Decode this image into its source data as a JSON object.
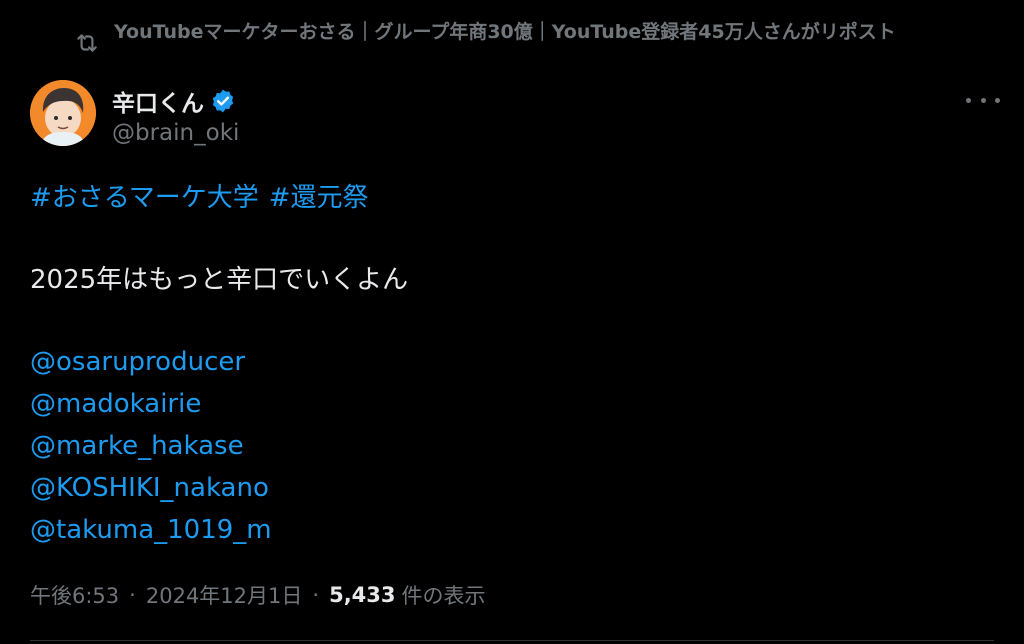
{
  "repost": {
    "text": "YouTubeマーケターおさる｜グループ年商30億｜YouTube登録者45万人さんがリポスト"
  },
  "author": {
    "display_name": "辛口くん",
    "handle": "@brain_oki",
    "verified_color": "#1d9bf0",
    "avatar_bg": "#f28a2b"
  },
  "post": {
    "hashtags": [
      "#おさるマーケ大学",
      "#還元祭"
    ],
    "line": "2025年はもっと辛口でいくよん",
    "mentions": [
      "@osaruproducer",
      "@madokairie",
      "@marke_hakase",
      "@KOSHIKI_nakano",
      "@takuma_1019_m"
    ]
  },
  "meta": {
    "time": "午後6:53",
    "dot1": "·",
    "date": "2024年12月1日",
    "dot2": "·",
    "views_count": "5,433",
    "views_label": "件の表示"
  },
  "colors": {
    "background": "#000000",
    "text": "#e7e9ea",
    "muted": "#71767b",
    "link": "#1d9bf0"
  }
}
